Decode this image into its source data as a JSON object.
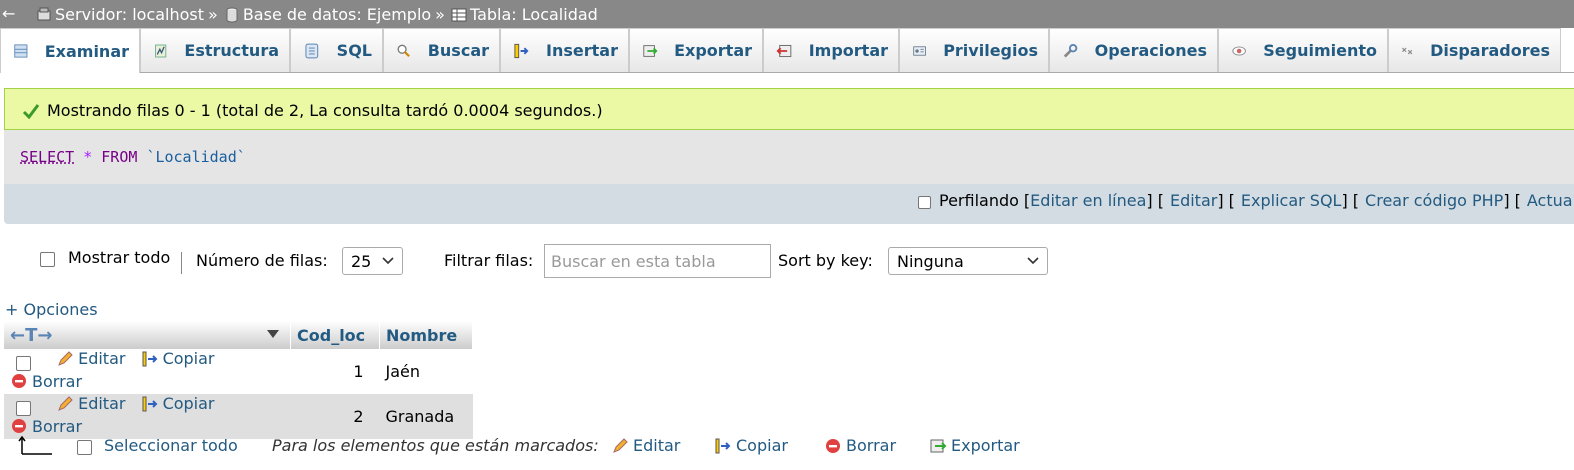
{
  "topbar": {
    "back_glyph": "←",
    "crumbs": [
      {
        "label": "Servidor: localhost",
        "icon": "server-icon"
      },
      {
        "label": "Base de datos: Ejemplo",
        "icon": "database-icon"
      },
      {
        "label": "Tabla: Localidad",
        "icon": "table-icon"
      }
    ],
    "separator": "»"
  },
  "tabs": [
    {
      "label": "Examinar",
      "icon": "browse-icon",
      "active": true
    },
    {
      "label": "Estructura",
      "icon": "structure-icon"
    },
    {
      "label": "SQL",
      "icon": "sql-icon"
    },
    {
      "label": "Buscar",
      "icon": "search-icon"
    },
    {
      "label": "Insertar",
      "icon": "insert-icon"
    },
    {
      "label": "Exportar",
      "icon": "export-icon"
    },
    {
      "label": "Importar",
      "icon": "import-icon"
    },
    {
      "label": "Privilegios",
      "icon": "privileges-icon"
    },
    {
      "label": "Operaciones",
      "icon": "wrench-icon"
    },
    {
      "label": "Seguimiento",
      "icon": "eye-icon"
    },
    {
      "label": "Disparadores",
      "icon": "triggers-icon"
    }
  ],
  "message": {
    "text": "Mostrando filas 0 - 1 (total de 2, La consulta tardó 0.0004 segundos.)",
    "icon": "check-icon"
  },
  "sql": {
    "select": "SELECT",
    "star": "*",
    "from": "FROM",
    "table": "`Localidad`"
  },
  "profiling": {
    "label": "Perfilando",
    "open": "[",
    "links": [
      "Editar en línea",
      "Editar",
      "Explicar SQL",
      "Crear código PHP",
      "Actua"
    ],
    "seps": [
      "] [",
      " ] [",
      " ] [",
      " ] ["
    ]
  },
  "controls": {
    "show_all": "Mostrar todo",
    "rows_label": "Número de filas:",
    "rows_value": "25",
    "filter_label": "Filtrar filas:",
    "filter_placeholder": "Buscar en esta tabla",
    "sort_label": "Sort by key:",
    "sort_value": "Ninguna"
  },
  "options_link": "+ Opciones",
  "table": {
    "arrows": "←T→",
    "columns": [
      "Cod_loc",
      "Nombre"
    ],
    "actions": [
      "Editar",
      "Copiar",
      "Borrar"
    ],
    "rows": [
      {
        "cod": "1",
        "nombre": "Jaén"
      },
      {
        "cod": "2",
        "nombre": "Granada"
      }
    ]
  },
  "bottom": {
    "select_all": "Seleccionar todo",
    "marked_label": "Para los elementos que están marcados:",
    "edit": "Editar",
    "copy": "Copiar",
    "delete": "Borrar",
    "export": "Exportar"
  },
  "colors": {
    "link": "#235a81",
    "success_bg": "#ebf8a4",
    "sql_bg": "#e5e5e5",
    "bar_bg": "#d3dce3"
  }
}
